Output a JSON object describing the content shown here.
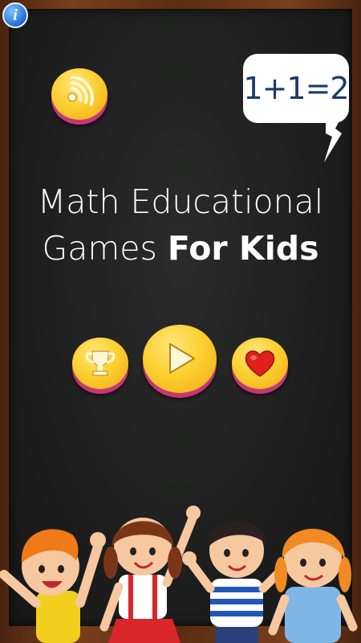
{
  "header": {
    "info_icon_glyph": "i"
  },
  "bubble": {
    "equation": "1+1=2"
  },
  "title": {
    "line1": "Math Educational",
    "line2_light": "Games ",
    "line2_bold": "For Kids"
  },
  "buttons": {
    "sound": "sound-icon",
    "trophy": "trophy-icon",
    "play": "play-icon",
    "favorite": "heart-icon"
  },
  "colors": {
    "board": "#1e1f1e",
    "frame": "#6b3618",
    "button_yellow": "#fcd032",
    "button_shadow": "#c8347a",
    "heart": "#e0201c"
  }
}
